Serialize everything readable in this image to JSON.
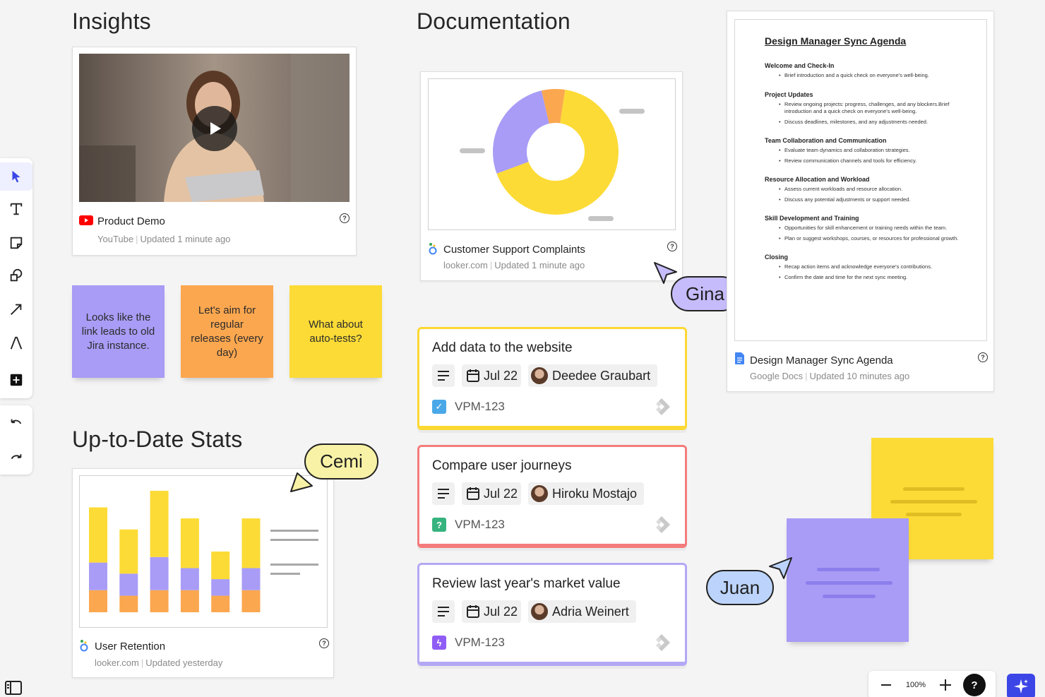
{
  "sections": {
    "insights": "Insights",
    "documentation": "Documentation",
    "stats": "Up-to-Date Stats"
  },
  "video_card": {
    "title": "Product Demo",
    "source": "YouTube",
    "updated": "Updated 1 minute ago"
  },
  "stickies": [
    {
      "text": "Looks like the link leads to old Jira instance.",
      "color": "#a89cf6"
    },
    {
      "text": "Let's aim for regular releases (every day)",
      "color": "#fba74f"
    },
    {
      "text": "What about auto-tests?",
      "color": "#fcdb36"
    }
  ],
  "support_card": {
    "title": "Customer Support Complaints",
    "source": "looker.com",
    "updated": "Updated 1 minute ago"
  },
  "retention_card": {
    "title": "User Retention",
    "source": "looker.com",
    "updated": "Updated yesterday"
  },
  "doc_card": {
    "title": "Design Manager Sync Agenda",
    "source": "Google Docs",
    "updated": "Updated 10 minutes ago",
    "doc_title": "Design Manager Sync Agenda",
    "sections": [
      {
        "heading": "Welcome and Check-In",
        "items": [
          "Brief introduction and a quick check on everyone's well-being."
        ]
      },
      {
        "heading": "Project Updates",
        "items": [
          "Review ongoing projects: progress, challenges, and any blockers.Brief introduction and a quick check on everyone's well-being.",
          "Discuss deadlines, milestones, and any adjustments needed."
        ]
      },
      {
        "heading": "Team Collaboration and Communication",
        "items": [
          "Evaluate team dynamics and collaboration strategies.",
          "Review communication channels and tools for efficiency."
        ]
      },
      {
        "heading": "Resource Allocation and Workload",
        "items": [
          "Assess current workloads and resource allocation.",
          "Discuss any potential adjustments or support needed."
        ]
      },
      {
        "heading": "Skill Development and Training",
        "items": [
          "Opportunities for skill enhancement or training needs within the team.",
          "Plan or suggest workshops, courses, or resources for professional growth."
        ]
      },
      {
        "heading": "Closing",
        "items": [
          "Recap action items and acknowledge everyone's contributions.",
          "Confirm the date and time for the next sync meeting."
        ]
      }
    ]
  },
  "tasks": [
    {
      "title": "Add data to the website",
      "date": "Jul 22",
      "assignee": "Deedee Graubart",
      "ticket": "VPM-123",
      "border": "#fcd832",
      "ticket_color": "#4aa8e8",
      "ticket_icon": "check-icon"
    },
    {
      "title": "Compare user journeys",
      "date": "Jul 22",
      "assignee": "Hiroku Mostajo",
      "ticket": "VPM-123",
      "border": "#f47c7c",
      "ticket_color": "#36b37e",
      "ticket_icon": "question-icon"
    },
    {
      "title": "Review last year's market value",
      "date": "Jul 22",
      "assignee": "Adria Weinert",
      "ticket": "VPM-123",
      "border": "#b3a8f5",
      "ticket_color": "#8f5df5",
      "ticket_icon": "bolt-icon"
    }
  ],
  "cursors": [
    {
      "name": "Gina",
      "color": "#c6bcfb"
    },
    {
      "name": "Cemi",
      "color": "#f7f2a6"
    },
    {
      "name": "Juan",
      "color": "#bcd4fb"
    }
  ],
  "zoom": "100%",
  "donut_chart": {
    "type": "pie",
    "values": [
      67,
      27,
      6
    ],
    "colors": [
      "#fcdb36",
      "#a89cf6",
      "#fba74f"
    ]
  },
  "bar_chart": {
    "type": "bar",
    "series": [
      {
        "values": [
          4,
          3,
          4,
          4,
          3,
          4
        ]
      },
      {
        "values": [
          5,
          4,
          6,
          4,
          3,
          4
        ]
      },
      {
        "values": [
          10,
          8,
          12,
          9,
          5,
          9
        ]
      }
    ],
    "colors": [
      "#fba74f",
      "#a89cf6",
      "#fcdb36"
    ],
    "ylim": [
      0,
      22
    ]
  }
}
